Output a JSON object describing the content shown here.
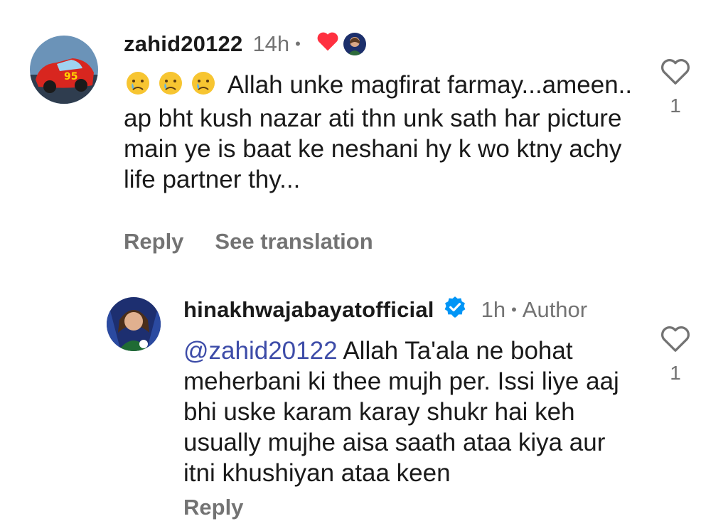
{
  "comments": [
    {
      "username": "zahid20122",
      "time": "14h",
      "separator": "•",
      "body_text": "Allah unke magfirat farmay...ameen.. ap bht kush nazar ati thn unk sath har picture main ye is baat ke neshani hy k wo ktny achy life partner thy...",
      "emoji_prefix": [
        "crying-face",
        "crying-face",
        "crying-face"
      ],
      "like_count": "1",
      "actions": {
        "reply": "Reply",
        "translate": "See translation"
      },
      "liked_by_author": true
    },
    {
      "username": "hinakhwajabayatofficial",
      "verified": true,
      "time": "1h",
      "separator": "•",
      "role_badge": "Author",
      "mention": "@zahid20122",
      "body_text": " Allah Ta'ala ne bohat meherbani ki thee mujh per. Issi liye aaj bhi uske karam karay shukr hai keh usually mujhe aisa saath ataa kiya aur itni khushiyan ataa keen",
      "like_count": "1",
      "actions": {
        "reply": "Reply"
      }
    }
  ],
  "colors": {
    "primary_text": "#1a1a1a",
    "secondary_text": "#737373",
    "heart_red": "#ff3040",
    "verified_blue": "#0095f6",
    "mention_blue": "#3d4ca8"
  }
}
